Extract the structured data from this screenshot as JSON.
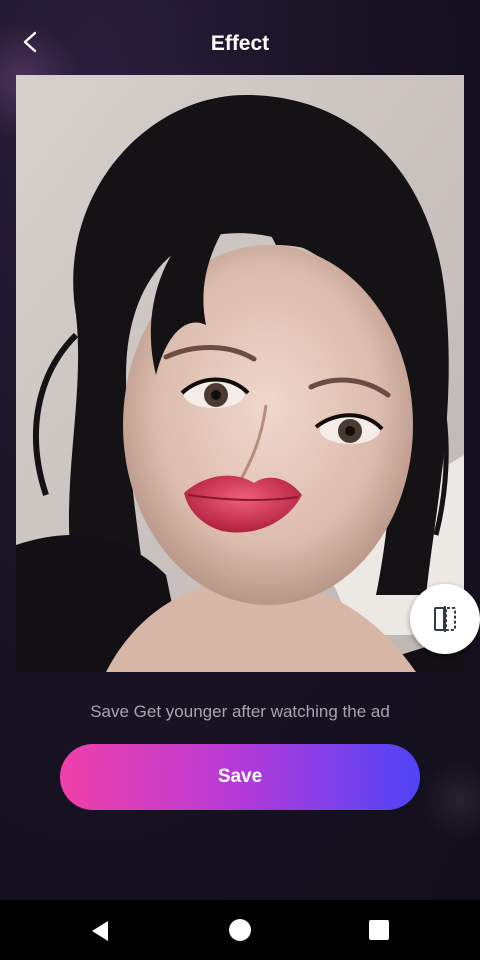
{
  "header": {
    "title": "Effect",
    "back_icon": "back-chevron-icon"
  },
  "photo": {
    "description_icon": "portrait-photo",
    "compare_icon": "compare-split-icon"
  },
  "caption": "Save Get younger after watching the ad",
  "actions": {
    "save_label": "Save"
  },
  "navbar": {
    "back_icon": "nav-back-icon",
    "home_icon": "nav-home-icon",
    "recent_icon": "nav-recent-apps-icon"
  },
  "colors": {
    "background": "#1a1426",
    "save_gradient_start": "#f040a8",
    "save_gradient_end": "#4e44f8",
    "title": "#ffffff",
    "caption": "#a8a4b0"
  }
}
